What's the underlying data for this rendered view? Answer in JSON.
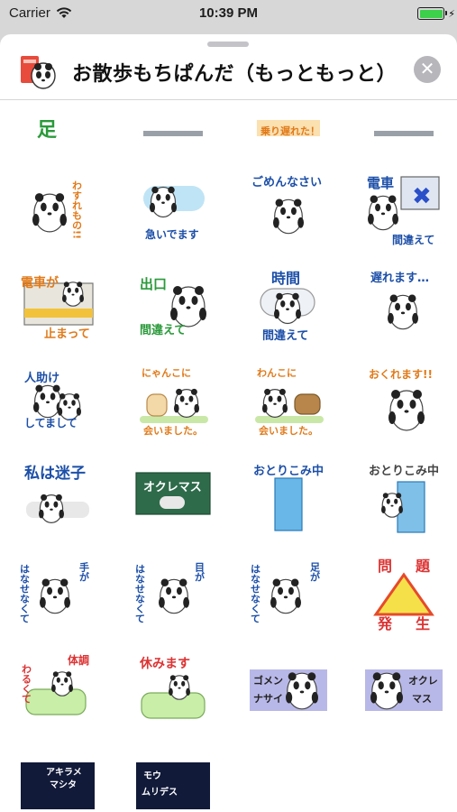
{
  "status_bar": {
    "carrier": "Carrier",
    "time": "10:39 PM",
    "battery_percent": 100,
    "battery_color": "#3dd04a"
  },
  "header": {
    "title": "お散歩もちぱんだ（もっともっと）",
    "close_icon": "close-icon",
    "app_icon": "panda-book-icon"
  },
  "stickers": [
    {
      "label": "",
      "kind": "partial-green"
    },
    {
      "label": "",
      "kind": "partial-gray"
    },
    {
      "label": "乗り遅れた！",
      "kind": "partial-orange"
    },
    {
      "label": "",
      "kind": "partial-gray"
    },
    {
      "label": "わすれもの!!",
      "kind": "panda-forgot"
    },
    {
      "label": "急いでます",
      "kind": "panda-hurry"
    },
    {
      "label": "ごめんなさい",
      "kind": "panda-sorry"
    },
    {
      "label": "電車 間違えて",
      "kind": "panda-train-wrong"
    },
    {
      "label": "電車が止まって",
      "kind": "panda-train-stop"
    },
    {
      "label": "出口 間違えて",
      "kind": "panda-exit"
    },
    {
      "label": "時間 間違えて",
      "kind": "panda-time"
    },
    {
      "label": "遅れます…",
      "kind": "panda-late"
    },
    {
      "label": "人助けしてまして",
      "kind": "panda-help"
    },
    {
      "label": "にゃんこに会いました。",
      "kind": "panda-cat"
    },
    {
      "label": "わんこに会いました。",
      "kind": "panda-dog"
    },
    {
      "label": "おくれます!!",
      "kind": "panda-tired"
    },
    {
      "label": "私は迷子",
      "kind": "panda-lost"
    },
    {
      "label": "オクレマス",
      "kind": "panda-board"
    },
    {
      "label": "おとりこみ中",
      "kind": "panda-door"
    },
    {
      "label": "おとりこみ中",
      "kind": "panda-door-peek"
    },
    {
      "label": "手がはなせなくて",
      "kind": "panda-hands"
    },
    {
      "label": "目がはなせなくて",
      "kind": "panda-eyes"
    },
    {
      "label": "足がはなせなくて",
      "kind": "panda-feet"
    },
    {
      "label": "問題発生",
      "kind": "panda-problem"
    },
    {
      "label": "体調わるくて",
      "kind": "panda-sick"
    },
    {
      "label": "休みます",
      "kind": "panda-rest"
    },
    {
      "label": "ゴメンナサイ",
      "kind": "panda-ghost-sorry"
    },
    {
      "label": "オクレマス",
      "kind": "panda-ghost-late"
    },
    {
      "label": "アキラメマシタ",
      "kind": "panda-dark-giveup"
    },
    {
      "label": "モウムリデス",
      "kind": "panda-dark-cant"
    }
  ]
}
